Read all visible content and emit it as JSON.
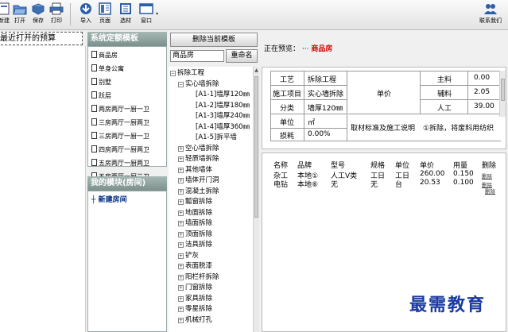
{
  "toolbar": {
    "new": "新建",
    "open": "打开",
    "save": "保存",
    "print": "打印",
    "import": "导入",
    "layout": "页面",
    "material": "选材",
    "window": "窗口",
    "contact": "联系我们"
  },
  "recent": {
    "label": "最近打开的预算"
  },
  "templates": {
    "header": "系统定额模板",
    "items": [
      "商品房",
      "单身公寓",
      "别墅",
      "跃层",
      "两房两厅一厨一卫",
      "三房两厅一厨两卫",
      "三房两厅一厨一卫",
      "四房两厅一厨两卫",
      "五房两厅一厨两卫",
      "五房两厅一厨三卫"
    ]
  },
  "module": {
    "header": "我的模块(房间)",
    "new_room": "新建房间"
  },
  "template_actions": {
    "delete_button": "删除当前模板",
    "name_value": "商品房",
    "rename_button": "重命名"
  },
  "tree": {
    "root": "拆除工程",
    "child": "实心墙拆除",
    "leaves": [
      "[A1-1]墙厚120㎜",
      "[A1-2]墙厚180㎜",
      "[A1-3]墙厚240㎜",
      "[A1-4]墙厚360㎜",
      "[A1-5]拆平墙"
    ],
    "items": [
      "空心墙拆除",
      "轻质墙拆除",
      "其他墙体",
      "墙体开门洞",
      "混凝土拆除",
      "瓢窗拆除",
      "地面拆除",
      "墙面拆除",
      "顶面拆除",
      "洁具拆除",
      "铲灰",
      "表面脱漆",
      "阳栏杆拆除",
      "门窗拆除",
      "家具拆除",
      "零星拆除",
      "机械打孔"
    ]
  },
  "preview": {
    "label": "正在预览：",
    "dots": "···",
    "name": "商品房"
  },
  "detail": {
    "craft_label": "工艺",
    "craft_value": "拆除工程",
    "project_label": "施工项目",
    "project_value": "实心墙拆除",
    "category_label": "分类",
    "category_value": "墙厚120㎜",
    "unit_label": "单位",
    "unit_value": "㎡",
    "loss_label": "损耗",
    "loss_value": "0.00%",
    "price_label": "单价",
    "standard_label": "取材标准及施工说明",
    "standard_value": "①拆除，将废料用纺织",
    "main_label": "主料",
    "main_value": "0.00",
    "aux_label": "辅料",
    "aux_value": "2.05",
    "labor_label": "人工",
    "labor_value": "39.00"
  },
  "materials": {
    "headers": [
      "名称",
      "品牌",
      "型号",
      "规格",
      "单位",
      "单价",
      "用量",
      "删除"
    ],
    "rows": [
      [
        "杂工",
        "本地①",
        "人工Ⅴ类",
        "工日",
        "工日",
        "260.00",
        "0.150",
        "删除"
      ],
      [
        "电钻",
        "本地⑥",
        "无",
        "无",
        "台",
        "20.53",
        "0.100",
        "删除"
      ]
    ],
    "extra_delete": "删除"
  },
  "watermark": {
    "text": "最需教育"
  }
}
